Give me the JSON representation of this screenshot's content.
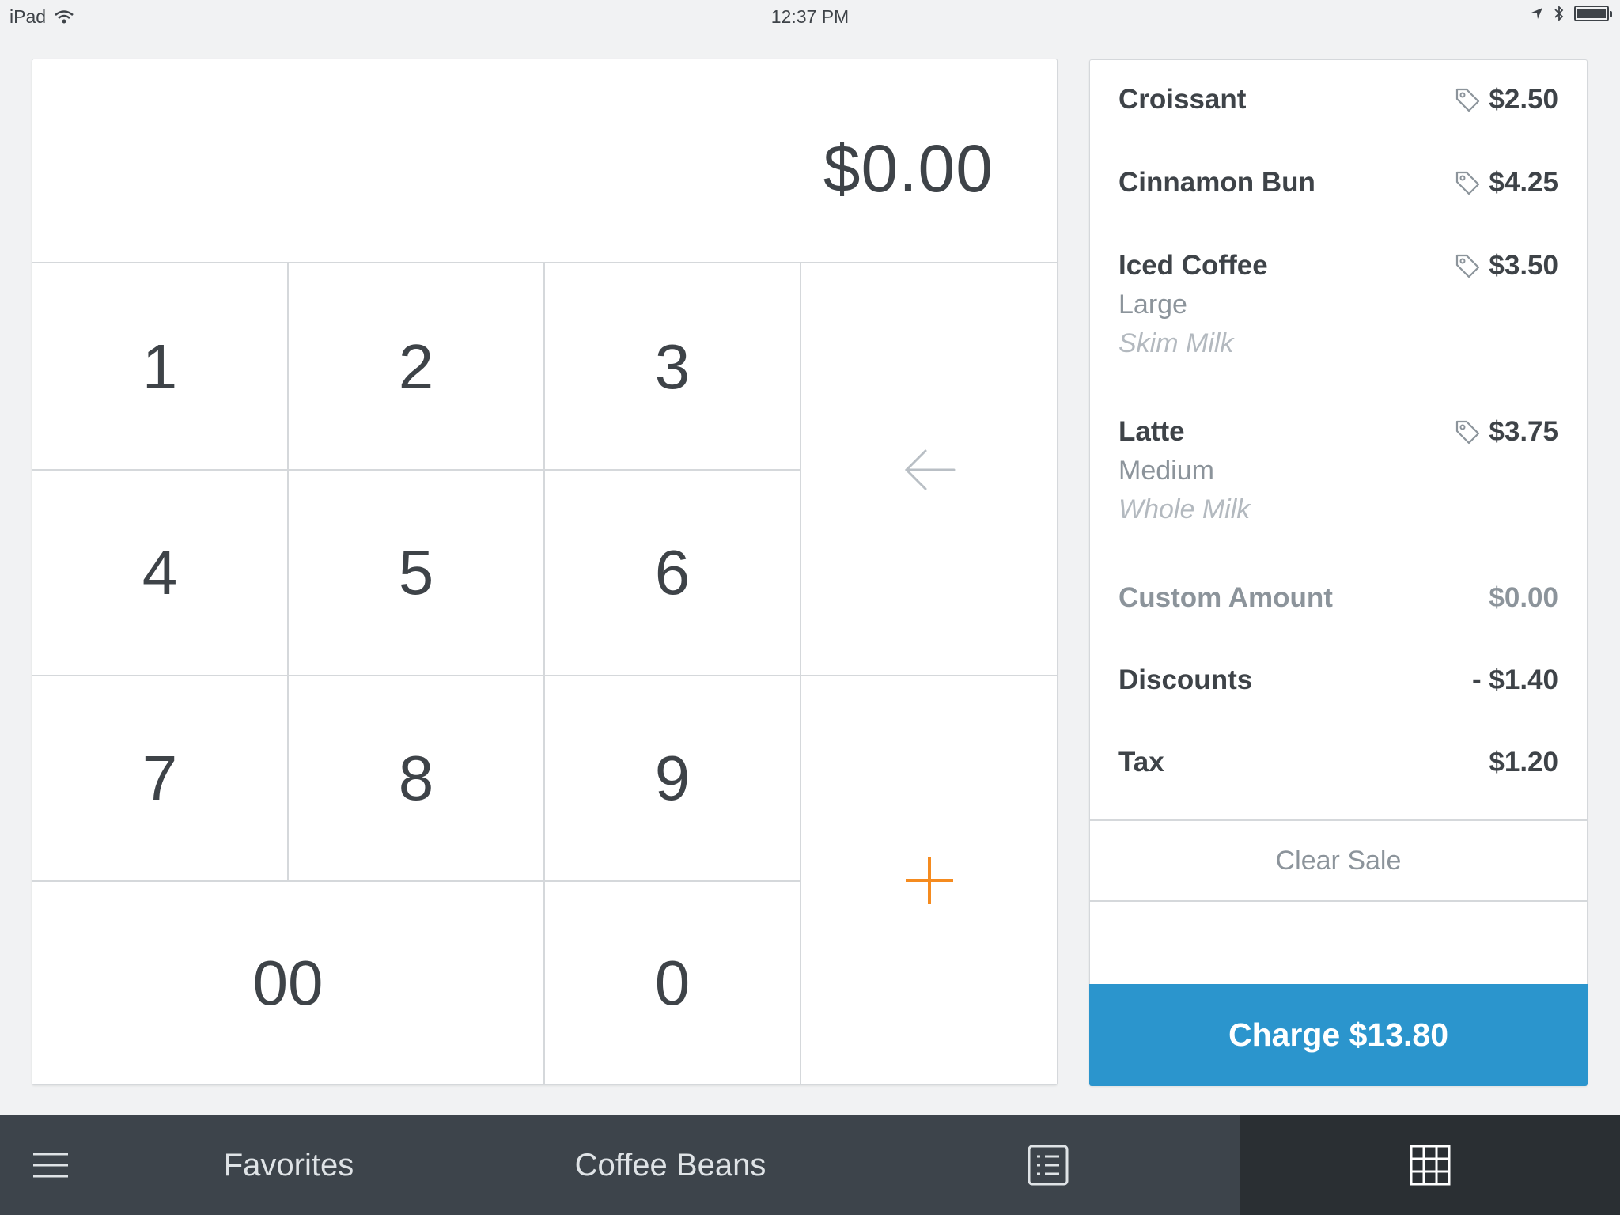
{
  "status_bar": {
    "device": "iPad",
    "time": "12:37 PM"
  },
  "keypad": {
    "amount": "$0.00",
    "keys": [
      "1",
      "2",
      "3",
      "4",
      "5",
      "6",
      "7",
      "8",
      "9",
      "00",
      "0"
    ]
  },
  "cart": {
    "items": [
      {
        "name": "Croissant",
        "price": "$2.50"
      },
      {
        "name": "Cinnamon Bun",
        "price": "$4.25"
      },
      {
        "name": "Iced Coffee",
        "price": "$3.50",
        "modifier": "Large",
        "note": "Skim Milk"
      },
      {
        "name": "Latte",
        "price": "$3.75",
        "modifier": "Medium",
        "note": "Whole Milk"
      }
    ],
    "custom_amount": {
      "label": "Custom Amount",
      "value": "$0.00"
    },
    "discounts": {
      "label": "Discounts",
      "value": "- $1.40"
    },
    "tax": {
      "label": "Tax",
      "value": "$1.20"
    },
    "clear_label": "Clear Sale",
    "charge_label": "Charge $13.80"
  },
  "bottom_bar": {
    "tabs": [
      {
        "label": "Favorites"
      },
      {
        "label": "Coffee Beans"
      }
    ]
  },
  "colors": {
    "accent_blue": "#2b95cd",
    "plus_orange": "#f58b1f",
    "bottom_bar": "#3d444b",
    "bottom_bar_active": "#2a2f33"
  }
}
